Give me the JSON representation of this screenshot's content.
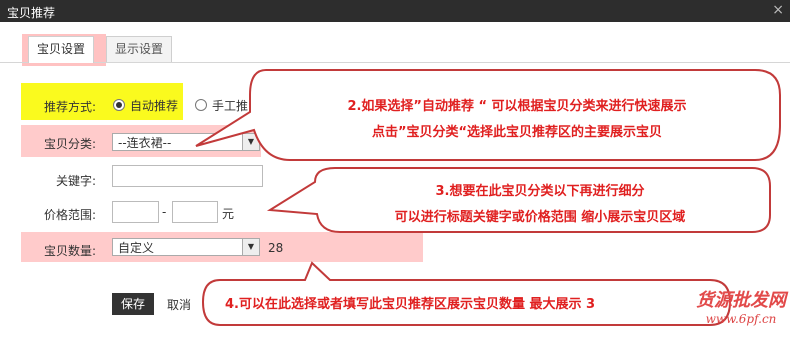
{
  "window": {
    "title": "宝贝推荐",
    "close_label": "×"
  },
  "tabs": [
    {
      "label": "宝贝设置",
      "active": true
    },
    {
      "label": "显示设置",
      "active": false
    }
  ],
  "form": {
    "recommend_mode": {
      "label": "推荐方式:",
      "options": [
        {
          "label": "自动推荐",
          "selected": true
        },
        {
          "label": "手工推",
          "selected": false
        }
      ]
    },
    "category": {
      "label": "宝贝分类:",
      "value": "--连衣裙--"
    },
    "keyword": {
      "label": "关键字:",
      "value": ""
    },
    "price_range": {
      "label": "价格范围:",
      "min": "",
      "max": "",
      "separator": "-",
      "unit": "元"
    },
    "quantity": {
      "label": "宝贝数量:",
      "mode": "自定义",
      "value": "28"
    }
  },
  "actions": {
    "save_label": "保存",
    "cancel_label": "取消"
  },
  "callouts": [
    {
      "line1": "2.如果选择”自动推荐 “ 可以根据宝贝分类来进行快速展示",
      "line2": "点击”宝贝分类“选择此宝贝推荐区的主要展示宝贝"
    },
    {
      "line1": "3.想要在此宝贝分类以下再进行细分",
      "line2": "可以进行标题关键字或价格范围 缩小展示宝贝区域"
    },
    {
      "line1": "4.可以在此选择或者填写此宝贝推荐区展示宝贝数量 最大展示 3",
      "line2": ""
    }
  ],
  "watermark": {
    "text": "货源批发网",
    "url": "www.6pf.cn"
  },
  "colors": {
    "callout_text": "#e02020",
    "highlight_yellow": "#fafa1e",
    "highlight_pink": "#ff8c8c"
  }
}
